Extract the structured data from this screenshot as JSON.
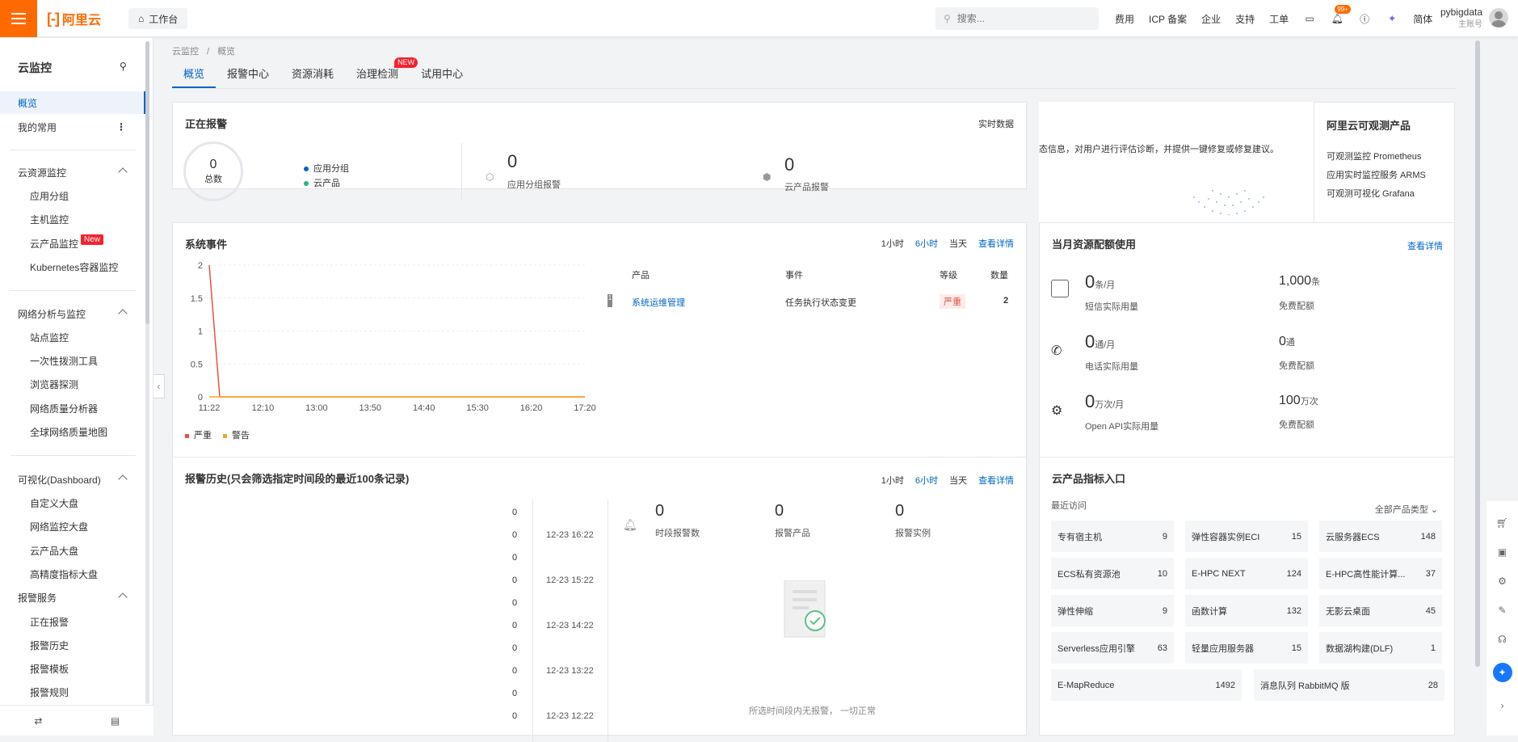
{
  "header": {
    "logo_text": "阿里云",
    "workbench": "工作台",
    "search_placeholder": "搜索...",
    "nav": [
      "费用",
      "ICP 备案",
      "企业",
      "支持",
      "工单"
    ],
    "notif_badge": "99+",
    "lang": "简体",
    "user_name": "pybigdata",
    "user_role": "主账号"
  },
  "sidebar": {
    "title": "云监控",
    "overview": "概览",
    "favorites": "我的常用",
    "groups": [
      {
        "label": "云资源监控",
        "items": [
          "应用分组",
          "主机监控",
          "云产品监控",
          "Kubernetes容器监控"
        ]
      },
      {
        "label": "网络分析与监控",
        "items": [
          "站点监控",
          "一次性拨测工具",
          "浏览器探测",
          "网络质量分析器",
          "全球网络质量地图"
        ]
      },
      {
        "label": "可视化(Dashboard)",
        "items": [
          "自定义大盘",
          "网络监控大盘",
          "云产品大盘",
          "高精度指标大盘"
        ]
      },
      {
        "label": "报警服务",
        "items": [
          "正在报警",
          "报警历史",
          "报警模板",
          "报警规则"
        ]
      }
    ],
    "new_tag": "New"
  },
  "breadcrumb": [
    "云监控",
    "/",
    "概览"
  ],
  "tabs": [
    "概览",
    "报警中心",
    "资源消耗",
    "治理检测",
    "试用中心"
  ],
  "tab_new": "NEW",
  "alarm": {
    "title": "正在报警",
    "realtime": "实时数据",
    "total_value": "0",
    "total_label": "总数",
    "legend": [
      "应用分组",
      "云产品"
    ],
    "app_group_value": "0",
    "app_group_label": "应用分组报警",
    "cloud_value": "0",
    "cloud_label": "云产品报警"
  },
  "banner": {
    "text": "态信息，对用户进行评估诊断，并提供一键修复或修复建议。"
  },
  "observ": {
    "title": "阿里云可观测产品",
    "items": [
      "可观测监控 Prometheus",
      "应用实时监控服务 ARMS",
      "可观测可视化 Grafana"
    ]
  },
  "events": {
    "title": "系统事件",
    "ranges": [
      "1小时",
      "6小时",
      "当天"
    ],
    "detail": "查看详情",
    "table_headers": [
      "产品",
      "事件",
      "等级",
      "数量"
    ],
    "row": {
      "product": "系统运维管理",
      "event": "任务执行状态变更",
      "level": "严重",
      "count": "2"
    },
    "legend": [
      "严重",
      "警告"
    ]
  },
  "chart_data": {
    "type": "line",
    "x": [
      "11:22",
      "12:10",
      "13:00",
      "13:50",
      "14:40",
      "15:30",
      "16:20",
      "17:20"
    ],
    "ylim": [
      0,
      2
    ],
    "yticks": [
      "2",
      "1.5",
      "1",
      "0.5",
      "0"
    ],
    "series": [
      {
        "name": "严重",
        "color": "#e8513e",
        "values": [
          2,
          0,
          0,
          0,
          0,
          0,
          0,
          0
        ]
      },
      {
        "name": "警告",
        "color": "#f5a623",
        "values": [
          0,
          0,
          0,
          0,
          0,
          0,
          0,
          0
        ]
      }
    ]
  },
  "quota": {
    "title": "当月资源配额使用",
    "detail": "查看详情",
    "rows": [
      {
        "used": "0",
        "used_unit": "条/月",
        "used_label": "短信实际用量",
        "free": "1,000",
        "free_unit": "条",
        "free_label": "免费配额"
      },
      {
        "used": "0",
        "used_unit": "通/月",
        "used_label": "电话实际用量",
        "free": "0",
        "free_unit": "通",
        "free_label": "免费配额"
      },
      {
        "used": "0",
        "used_unit": "万次/月",
        "used_label": "Open API实际用量",
        "free": "100",
        "free_unit": "万次",
        "free_label": "免费配额"
      }
    ]
  },
  "history": {
    "title": "报警历史(只会筛选指定时间段的最近100条记录)",
    "ranges": [
      "1小时",
      "6小时",
      "当天"
    ],
    "detail": "查看详情",
    "values": [
      "0",
      "0",
      "0",
      "0",
      "0",
      "0",
      "0",
      "0",
      "0",
      "0"
    ],
    "times": [
      "12-23 16:22",
      "12-23 15:22",
      "12-23 14:22",
      "12-23 13:22",
      "12-23 12:22"
    ],
    "stats": [
      {
        "value": "0",
        "label": "时段报警数"
      },
      {
        "value": "0",
        "label": "报警产品"
      },
      {
        "value": "0",
        "label": "报警实例"
      }
    ],
    "empty": "所选时间段内无报警， 一切正常"
  },
  "metrics": {
    "title": "云产品指标入口",
    "recent": "最近访问",
    "filter": "全部产品类型",
    "items": [
      {
        "name": "专有宿主机",
        "count": "9"
      },
      {
        "name": "弹性容器实例ECI",
        "count": "15"
      },
      {
        "name": "云服务器ECS",
        "count": "148"
      },
      {
        "name": "ECS私有资源池",
        "count": "10"
      },
      {
        "name": "E-HPC NEXT",
        "count": "124"
      },
      {
        "name": "E-HPC高性能计算...",
        "count": "37"
      },
      {
        "name": "弹性伸缩",
        "count": "9"
      },
      {
        "name": "函数计算",
        "count": "132"
      },
      {
        "name": "无影云桌面",
        "count": "45"
      },
      {
        "name": "Serverless应用引擎",
        "count": "63"
      },
      {
        "name": "轻量应用服务器",
        "count": "15"
      },
      {
        "name": "数据湖构建(DLF)",
        "count": "1"
      },
      {
        "name": "E-MapReduce",
        "count": "1492"
      },
      {
        "name": "消息队列 RabbitMQ 版",
        "count": "28"
      }
    ]
  }
}
